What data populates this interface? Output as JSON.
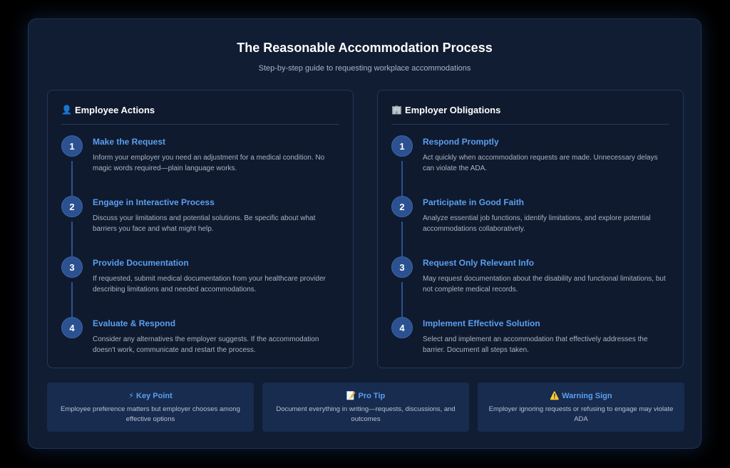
{
  "title": "The Reasonable Accommodation Process",
  "subtitle": "Step-by-step guide to requesting workplace accommodations",
  "employee": {
    "icon": "👤",
    "heading": "Employee Actions",
    "steps": [
      {
        "num": "1",
        "title": "Make the Request",
        "desc": "Inform your employer you need an adjustment for a medical condition. No magic words required—plain language works."
      },
      {
        "num": "2",
        "title": "Engage in Interactive Process",
        "desc": "Discuss your limitations and potential solutions. Be specific about what barriers you face and what might help."
      },
      {
        "num": "3",
        "title": "Provide Documentation",
        "desc": "If requested, submit medical documentation from your healthcare provider describing limitations and needed accommodations."
      },
      {
        "num": "4",
        "title": "Evaluate & Respond",
        "desc": "Consider any alternatives the employer suggests. If the accommodation doesn't work, communicate and restart the process."
      }
    ]
  },
  "employer": {
    "icon": "🏢",
    "heading": "Employer Obligations",
    "steps": [
      {
        "num": "1",
        "title": "Respond Promptly",
        "desc": "Act quickly when accommodation requests are made. Unnecessary delays can violate the ADA."
      },
      {
        "num": "2",
        "title": "Participate in Good Faith",
        "desc": "Analyze essential job functions, identify limitations, and explore potential accommodations collaboratively."
      },
      {
        "num": "3",
        "title": "Request Only Relevant Info",
        "desc": "May request documentation about the disability and functional limitations, but not complete medical records."
      },
      {
        "num": "4",
        "title": "Implement Effective Solution",
        "desc": "Select and implement an accommodation that effectively addresses the barrier. Document all steps taken."
      }
    ]
  },
  "notes": [
    {
      "icon": "⚡",
      "title": "Key Point",
      "desc": "Employee preference matters but employer chooses among effective options"
    },
    {
      "icon": "📝",
      "title": "Pro Tip",
      "desc": "Document everything in writing—requests, discussions, and outcomes"
    },
    {
      "icon": "⚠️",
      "title": "Warning Sign",
      "desc": "Employer ignoring requests or refusing to engage may violate ADA"
    }
  ]
}
